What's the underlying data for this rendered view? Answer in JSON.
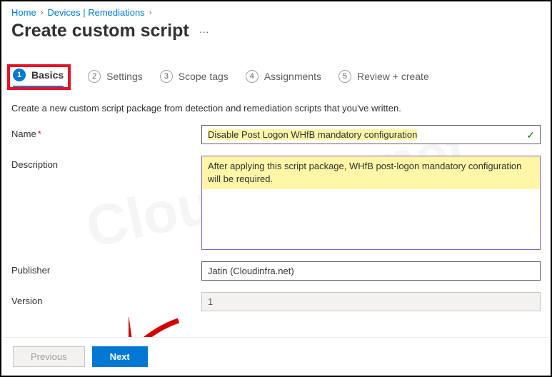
{
  "breadcrumb": {
    "home": "Home",
    "devices": "Devices | Remediations"
  },
  "page_title": "Create custom script",
  "wizard": {
    "steps": [
      {
        "num": "1",
        "label": "Basics"
      },
      {
        "num": "2",
        "label": "Settings"
      },
      {
        "num": "3",
        "label": "Scope tags"
      },
      {
        "num": "4",
        "label": "Assignments"
      },
      {
        "num": "5",
        "label": "Review + create"
      }
    ]
  },
  "intro_text": "Create a new custom script package from detection and remediation scripts that you've written.",
  "form": {
    "name_label": "Name",
    "name_value": "Disable Post Logon WHfB mandatory configuration",
    "description_label": "Description",
    "description_value": "After applying this script package, WHfB post-logon mandatory configuration will be required.",
    "publisher_label": "Publisher",
    "publisher_value": "Jatin (Cloudinfra.net)",
    "version_label": "Version",
    "version_value": "1"
  },
  "footer": {
    "previous": "Previous",
    "next": "Next"
  },
  "watermark": "Cloudinfra.net"
}
